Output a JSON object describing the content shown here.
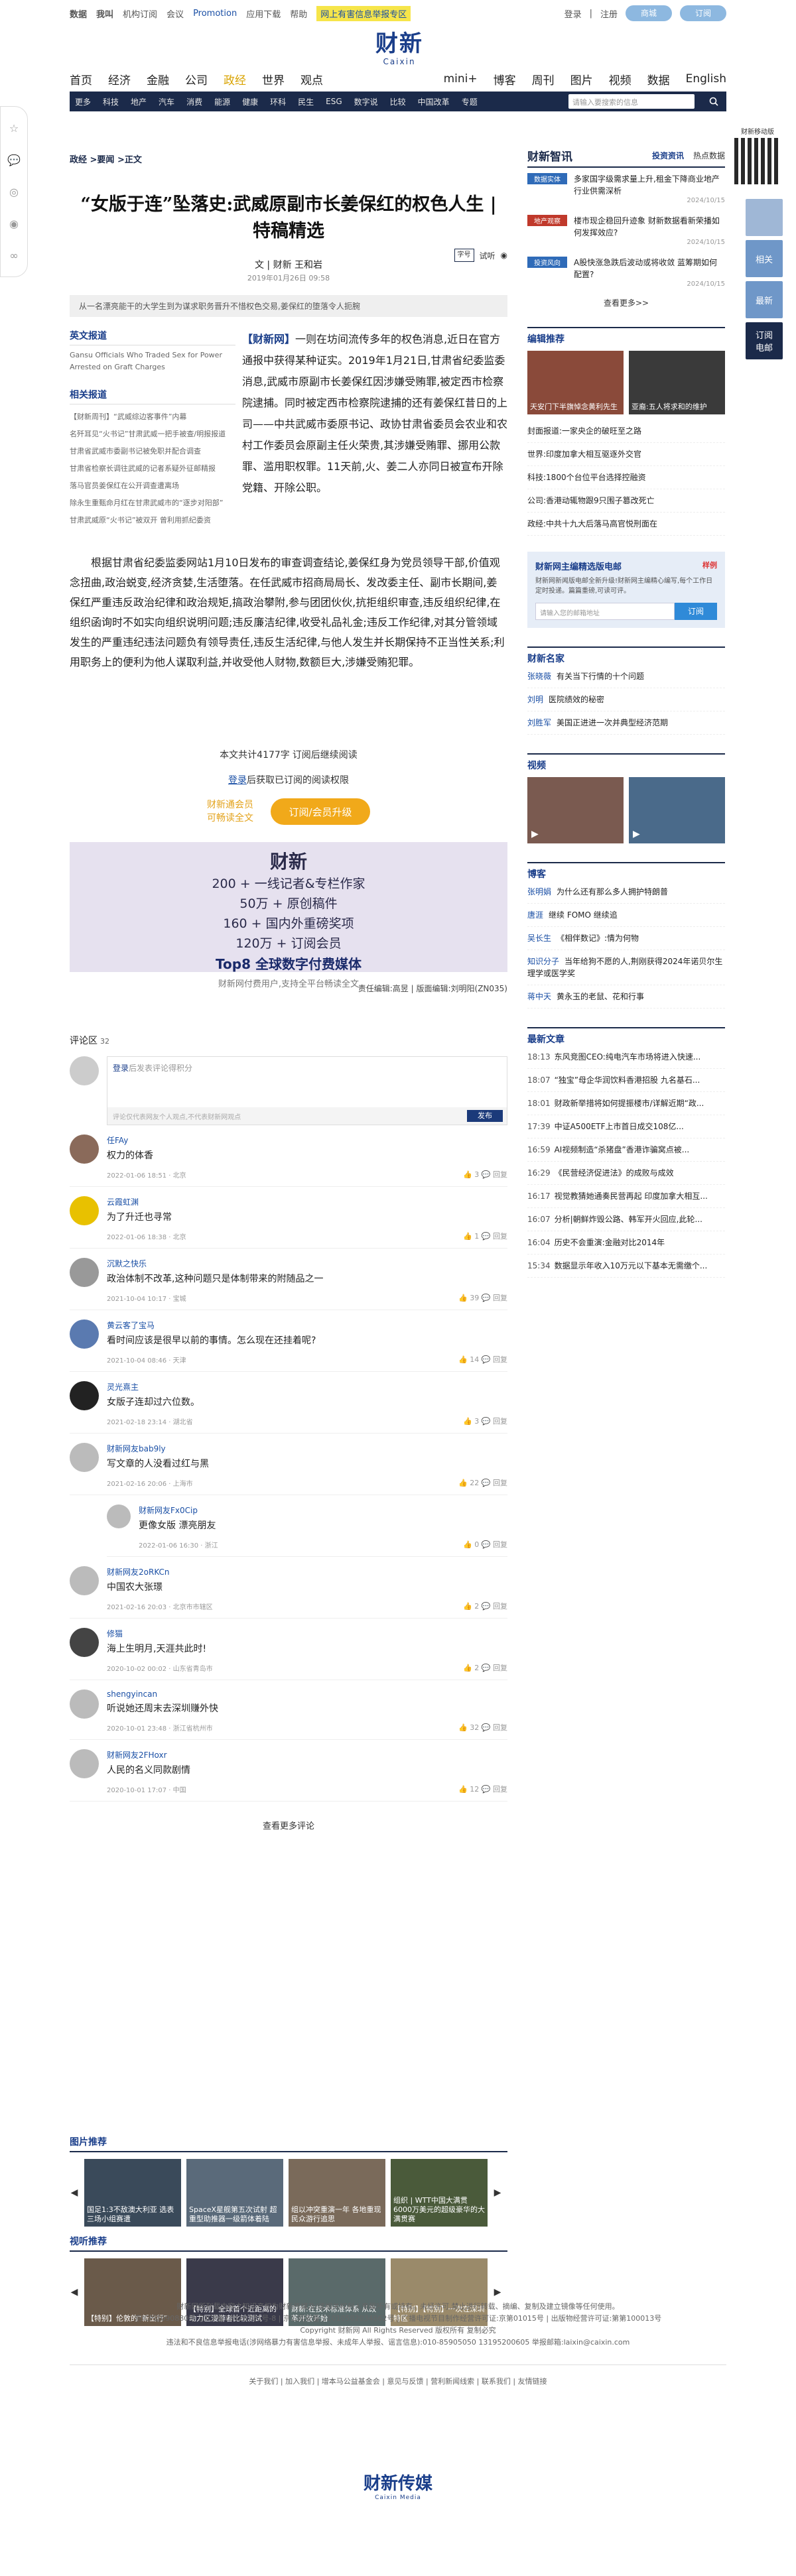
{
  "topbar": {
    "items": [
      "数据",
      "我叫",
      "机构订阅",
      "会议",
      "Promotion",
      "应用下载",
      "帮助"
    ],
    "yellow": "网上有害信息举报专区",
    "login": "登录",
    "register": "注册",
    "btn1": "商城",
    "btn2": "订阅"
  },
  "logo": {
    "cn": "财新",
    "en": "Caixin"
  },
  "nav": {
    "items": [
      "首页",
      "经济",
      "金融",
      "公司",
      "政经",
      "世界",
      "观点",
      "mini+",
      "博客",
      "周刊",
      "图片",
      "视频",
      "数据",
      "English"
    ],
    "active_index": 4
  },
  "subnav": {
    "items": [
      "更多",
      "科技",
      "地产",
      "汽车",
      "消费",
      "能源",
      "健康",
      "环科",
      "民生",
      "ESG",
      "数字说",
      "比较",
      "中国改革",
      "专题"
    ],
    "search_placeholder": "请输入要搜索的信息"
  },
  "share": {
    "icons": [
      "star-icon",
      "chat-icon",
      "wechat-icon",
      "weibo-icon",
      "link-icon"
    ]
  },
  "qr": {
    "label": "财新移动版"
  },
  "rbtns": [
    {
      "label": "",
      "color": "#9fb7d6"
    },
    {
      "label": "相关",
      "color": "#6f97c8"
    },
    {
      "label": "最新",
      "color": "#6f97c8"
    },
    {
      "label": "订阅\n电邮",
      "color": "#1b2a4a"
    }
  ],
  "article": {
    "crumb": "政经 >要闻 >正文",
    "title": "“女版于连”坠落史:武威原副市长姜保红的权色人生 | 特稿精选",
    "byline": "文 | 财新 王和岩",
    "date": "2019年01月26日 09:58",
    "tools": {
      "font": "字号",
      "listen": "试听"
    },
    "summary": "从一名漂亮能干的大学生到为谋求职务晋升不惜权色交易,姜保红的堕落令人扼腕",
    "english_h": "英文报道",
    "english_p": "Gansu Officials Who Traded Sex for Power Arrested on Graft Charges",
    "related_h": "相关报道",
    "related": [
      "【财新周刊】“武威综边客事件”内幕",
      "名歼耳见“火书记”甘肃武威一把手被查/明报报道",
      "甘肃省武威市委副书记被免职并配合调查",
      "甘肃省检察长调往武威的记者系疑外征邮精报",
      "落马官员姜保红在公开调查遭离场",
      "除永生重甄命月红在甘肃武威市的“逐步对阳部”",
      "甘肃武威原“火书记”被双开 曾利用抓纪委资"
    ],
    "lead_tag": "【财新网】",
    "lead": "一则在坊间流传多年的权色消息,近日在官方通报中获得某种证实。2019年1月21日,甘肃省纪委监委消息,武威市原副市长姜保红因涉嫌受贿罪,被定西市检察院逮捕。同时被定西市检察院逮捕的还有姜保红昔日的上司——中共武威市委原书记、政协甘肃省委员会农业和农村工作委员会原副主任火荣贵,其涉嫌受贿罪、挪用公款罪、滥用职权罪。11天前,火、姜二人亦同日被宣布开除党籍、开除公职。",
    "body": "根据甘肃省纪委监委网站1月10日发布的审查调查结论,姜保红身为党员领导干部,价值观念扭曲,政治蜕变,经济贪婪,生活堕落。在任武威市招商局局长、发改委主任、副市长期间,姜保红严重违反政治纪律和政治规矩,搞政治攀附,参与团团伙伙,抗拒组织审查,违反组织纪律,在组织函询时不如实向组织说明问题;违反廉洁纪律,收受礼品礼金;违反工作纪律,对其分管领域发生的严重违纪违法问题负有领导责任,违反生活纪律,与他人发生并长期保持不正当性关系;利用职务上的便利为他人谋取利益,并收受他人财物,数额巨大,涉嫌受贿犯罪。",
    "count": "本文共计4177字",
    "count_sub": "订阅后继续阅读",
    "login_b": "登录",
    "login_t": "后获取已订阅的阅读权限",
    "sub_t1": "财新通会员",
    "sub_t2": "可畅读全文",
    "sub_btn": "订阅/会员升级",
    "ad": {
      "logo": "财新",
      "l1": "200 + 一线记者&专栏作家",
      "l2": "50万 + 原创稿件",
      "l3": "160 + 国内外重磅奖项",
      "l4": "120万 + 订阅会员",
      "big": "Top8 全球数字付费媒体",
      "sm": "财新网付费用户,支持全平台畅读全文"
    },
    "editor": "责任编辑:高昱 | 版面编辑:刘明阳(ZN035)"
  },
  "comments": {
    "label": "评论区",
    "count": "32",
    "login": "登录",
    "login_tip": "后发表评论得积分",
    "placeholder": "评论仅代表网友个人观点,不代表财新网观点",
    "submit": "发布",
    "items": [
      {
        "name": "任FAy",
        "text": "权力的体香",
        "time": "2022-01-06 18:51 · 北京",
        "likes": "3",
        "reply": false,
        "av": "#8a6a5a"
      },
      {
        "name": "云霞虹渊",
        "text": "为了升迁也寻常",
        "time": "2022-01-06 18:38 · 北京",
        "likes": "1",
        "reply": false,
        "av": "#e8c100"
      },
      {
        "name": "沉默之快乐",
        "text": "政治体制不改革,这种问题只是体制带来的附随品之一",
        "time": "2021-10-04 10:17 · 宝城",
        "likes": "39",
        "reply": false,
        "av": "#999"
      },
      {
        "name": "黄云客了宝马",
        "text": "看时间应该是很早以前的事情。怎么现在还挂着呢?",
        "time": "2021-10-04 08:46 · 天津",
        "likes": "14",
        "reply": false,
        "av": "#5a7ab0"
      },
      {
        "name": "灵光熹主",
        "text": "女版子连却过六位数。",
        "time": "2021-02-18 23:14 · 湖北省",
        "likes": "3",
        "reply": false,
        "av": "#222"
      },
      {
        "name": "财新网友bab9ly",
        "text": "写文章的人没看过红与黑",
        "time": "2021-02-16 20:06 · 上海市",
        "likes": "22",
        "reply": false,
        "av": "#bbb"
      },
      {
        "name": "财新网友Fx0Cip",
        "text": "更像女版 漂亮朋友",
        "time": "2022-01-06 16:30 · 浙江",
        "likes": "0",
        "reply": true,
        "av": "#bbb"
      },
      {
        "name": "财新网友2oRKCn",
        "text": "中国农大张璟",
        "time": "2021-02-16 20:03 · 北京市市辖区",
        "likes": "2",
        "reply": false,
        "av": "#bbb"
      },
      {
        "name": "修猫",
        "text": "海上生明月,天涯共此时!",
        "time": "2020-10-02 00:02 · 山东省青岛市",
        "likes": "2",
        "reply": false,
        "av": "#444"
      },
      {
        "name": "shengyincan",
        "text": "听说她还周末去深圳赚外快",
        "time": "2020-10-01 23:48 · 浙江省杭州市",
        "likes": "32",
        "reply": false,
        "av": "#bbb"
      },
      {
        "name": "财新网友2FHoxr",
        "text": "人民的名义同款剧情",
        "time": "2020-10-01 17:07 · 中国",
        "likes": "12",
        "reply": false,
        "av": "#bbb"
      }
    ],
    "more": "查看更多评论"
  },
  "right": {
    "hot_logo": "财新智讯",
    "hot_tabs": [
      "投资资讯",
      "热点数据"
    ],
    "hot": [
      {
        "tag": "数据实体",
        "color": "#2f6bb8",
        "text": "多家国字级需求量上升,租金下降商业地产行业供需深析",
        "date": "2024/10/15"
      },
      {
        "tag": "地产观察",
        "color": "#c0392b",
        "text": "楼市现企稳回升迹象 财新数据看新荣播如何发挥效应?",
        "date": "2024/10/15"
      },
      {
        "tag": "投资风向",
        "color": "#2f6bb8",
        "text": "A股快涨急跌后波动或将收敛 蓝筹期如何配置?",
        "date": "2024/10/15"
      }
    ],
    "hot_more": "查看更多>>",
    "editor_h": "编辑推荐",
    "editor_pics": [
      {
        "text": "天安门下半旗悼念黄利先生",
        "color": "#8a4a3a"
      },
      {
        "text": "亚裔:五人将求和的维护",
        "color": "#3a3a3a"
      }
    ],
    "editor_list": [
      "封面报道:一家央企的破旺至之路",
      "世界:印度加拿大相互驱逐外交官",
      "科技:1800个台位平台选择控融资",
      "公司:香港动辄物跟9只围子篡改死亡",
      "政经:中共十九大后落马高官悦刑面在"
    ],
    "nl_h": "财新网主编精选版电邮",
    "nl_tag": "样例",
    "nl_p": "财新网新闻版电邮全新升级!财新网主编精心编写,每个工作日定时投递。篇篇重磅,可读可评。",
    "nl_input": "请输入您的邮箱地址",
    "nl_btn": "订阅",
    "name_h": "财新名家",
    "names": [
      {
        "n": "张晓薇",
        "t": "有关当下行情的十个问题"
      },
      {
        "n": "刘明",
        "t": "医院绩效的秘密"
      },
      {
        "n": "刘胜军",
        "t": "美国正进进一次并典型经济范期"
      }
    ],
    "video_h": "视频",
    "videos": [
      {
        "text": "",
        "color": "#7a5a50"
      },
      {
        "text": "",
        "color": "#4a6a8a"
      }
    ],
    "blog_h": "博客",
    "blogs": [
      {
        "n": "张明娟",
        "t": "为什么还有那么多人拥护特朗普"
      },
      {
        "n": "唐涯",
        "t": "继续 FOMO 继续追"
      },
      {
        "n": "吴长生",
        "t": "《相伴数记》:情为何物"
      },
      {
        "n": "知识分子",
        "t": "当年给狗不愿的人,荆刚获得2024年诺贝尔生理学或医学奖"
      },
      {
        "n": "蒋中天",
        "t": "黄永玉的老鼠、花和行事"
      }
    ],
    "news_h": "最新文章",
    "news": [
      {
        "t": "18:13",
        "x": "东风竞图CEO:纯电汽车市场将进入快速..."
      },
      {
        "t": "18:07",
        "x": "“独宝”母企华润饮料香港招股 九名基石..."
      },
      {
        "t": "18:01",
        "x": "财政新举措将如何提振楼市/详解近期“政..."
      },
      {
        "t": "17:39",
        "x": "中证A500ETF上市首日成交108亿..."
      },
      {
        "t": "16:59",
        "x": "AI视频制造“杀猪盘”香港诈骗窝点被..."
      },
      {
        "t": "16:29",
        "x": "《民营经济促进法》的成败与成效"
      },
      {
        "t": "16:17",
        "x": "视觉教猜她通奏民营再起 印度加拿大相互..."
      },
      {
        "t": "16:07",
        "x": "分析|朝鲜炸毁公路、韩军开火回应,此轮..."
      },
      {
        "t": "16:04",
        "x": "历史不会重演:金融对比2014年"
      },
      {
        "t": "15:34",
        "x": "数据显示年收入10万元以下基本无需缴个..."
      }
    ]
  },
  "gallery1": {
    "h": "图片推荐",
    "items": [
      {
        "t": "国足1:3不敌澳大利亚 选表三场小组赛遭",
        "c": "#3a4a5a"
      },
      {
        "t": "SpaceX星舰第五次试射 超重型助推器一级箭体着陆",
        "c": "#5a6a7a"
      },
      {
        "t": "组以冲突重演一年 各地重现民众游行追思",
        "c": "#7a6a5a"
      },
      {
        "t": "组织 | WTT中国大满贯 6000万美元的超级豪华的大满贯赛",
        "c": "#4a5a3a"
      }
    ]
  },
  "gallery2": {
    "h": "视听推荐",
    "items": [
      {
        "t": "【特别】伦敦的“新出行”",
        "c": "#6a5a4a"
      },
      {
        "t": "【特别】全球首个近距离的 动力区漫游者比较测试",
        "c": "#3a3a4a"
      },
      {
        "t": "财新:在技术标准体系 从改革开放开始",
        "c": "#5a6a6a"
      },
      {
        "t": "【特别】【特别】一次在深圳特区",
        "c": "#9a8a6a"
      }
    ]
  },
  "footer": {
    "l1": "财新网所刊载内容之知识产权为财新传媒及/或相关权利人专属所有或持有。未经许可,禁止进行转载、摘编、复制及建立镜像等任何使用。",
    "l2": "京ICP证090880号 京ICP备10026701号-8 | 京公网安备 11010502034662号 | 广播电视节目制作经营许可证:京第01015号 | 出版物经营许可证:第第100013号",
    "l3": "Copyright 财新网 All Rights Reserved 版权所有 复制必究",
    "l4": "违法和不良信息举报电话(涉网络暴力有害信息举报、未成年人举报、谣言信息):010-85905050 13195200605 举报邮箱:laixin@caixin.com",
    "links": "关于我们 | 加入我们 | 增本马公益基金会 | 意见与反馈 | 营利新闻线索 | 联系我们 | 友情链接",
    "logo": "财新传媒",
    "logo_en": "Caixin Media"
  }
}
